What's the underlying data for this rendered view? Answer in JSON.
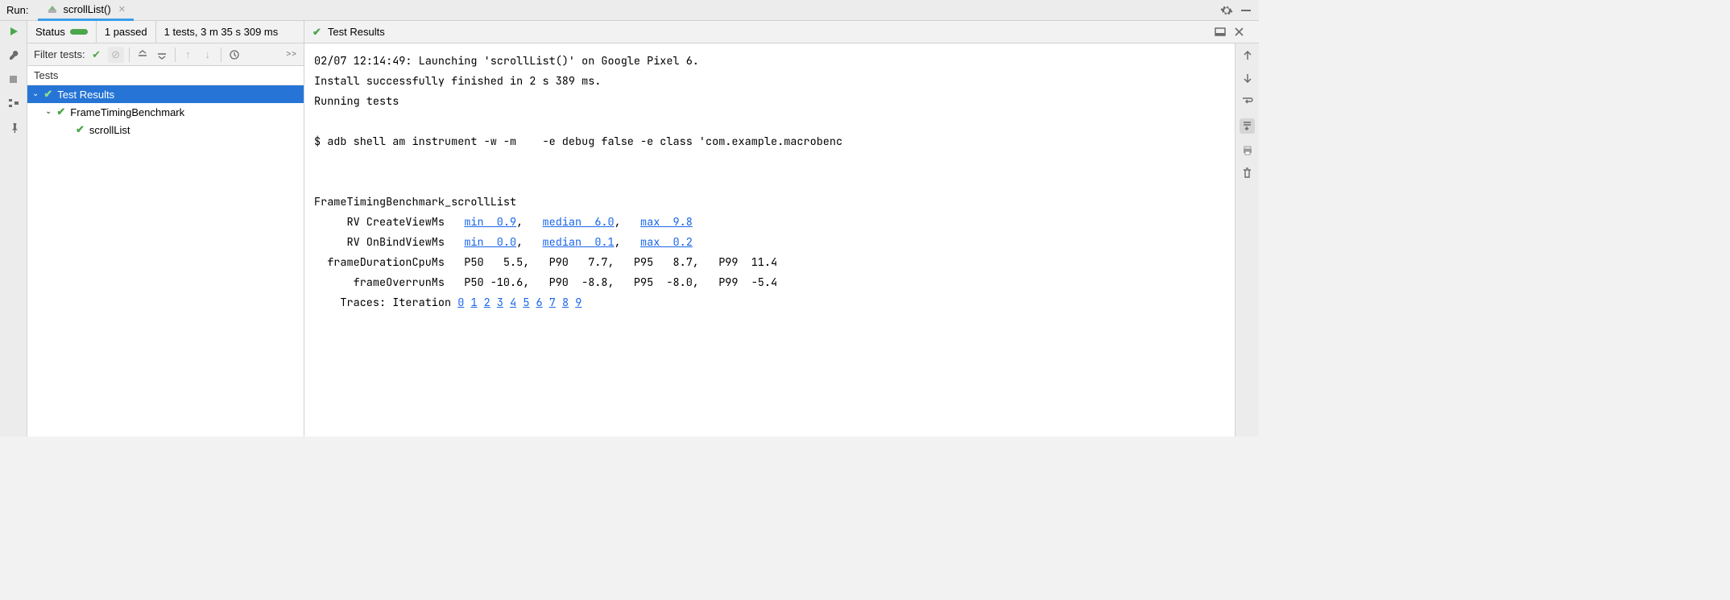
{
  "top": {
    "run_label": "Run:",
    "tab_title": "scrollList()"
  },
  "status": {
    "status_label": "Status",
    "passed": "1 passed",
    "summary": "1 tests, 3 m 35 s 309 ms",
    "results_title": "Test Results"
  },
  "filter": {
    "label": "Filter tests:"
  },
  "tree": {
    "header": "Tests",
    "root": "Test Results",
    "suite": "FrameTimingBenchmark",
    "test": "scrollList"
  },
  "console": {
    "line1": "02/07 12:14:49: Launching 'scrollList()' on Google Pixel 6.",
    "line2": "Install successfully finished in 2 s 389 ms.",
    "line3": "Running tests",
    "line4": "$ adb shell am instrument -w -m    -e debug false -e class 'com.example.macrobenc",
    "bench_name": "FrameTimingBenchmark_scrollList",
    "row1_label": "RV CreateViewMs",
    "row1_min": "min  0.9",
    "row1_med": "median  6.0",
    "row1_max": "max  9.8",
    "row2_label": "RV OnBindViewMs",
    "row2_min": "min  0.0",
    "row2_med": "median  0.1",
    "row2_max": "max  0.2",
    "row3": "  frameDurationCpuMs   P50   5.5,   P90   7.7,   P95   8.7,   P99  11.4",
    "row4": "      frameOverrunMs   P50 -10.6,   P90  -8.8,   P95  -8.0,   P99  -5.4",
    "traces_label": "Traces: Iteration",
    "traces": [
      "0",
      "1",
      "2",
      "3",
      "4",
      "5",
      "6",
      "7",
      "8",
      "9"
    ]
  }
}
